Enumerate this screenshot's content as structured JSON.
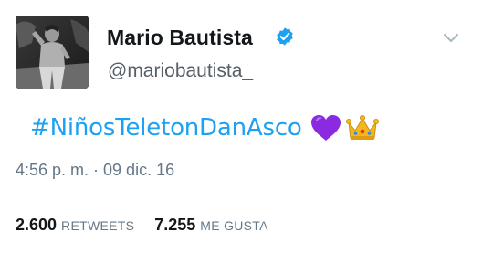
{
  "user": {
    "display_name": "Mario Bautista",
    "handle": "@mariobautista_",
    "verified": true,
    "avatar_icon": "profile-photo"
  },
  "tweet": {
    "hashtag": "#NiñosTeletonDanAsco",
    "emojis": [
      "purple-heart",
      "crown"
    ],
    "timestamp": "4:56 p. m. · 09 dic. 16"
  },
  "stats": {
    "retweets_count": "2.600",
    "retweets_label": "RETWEETS",
    "likes_count": "7.255",
    "likes_label": "ME GUSTA"
  },
  "colors": {
    "link": "#1da1f2",
    "verified_badge": "#1da1f2",
    "name": "#14171a",
    "secondary": "#657786",
    "heart": "#8a2be2",
    "crown": "#f5b81c"
  }
}
